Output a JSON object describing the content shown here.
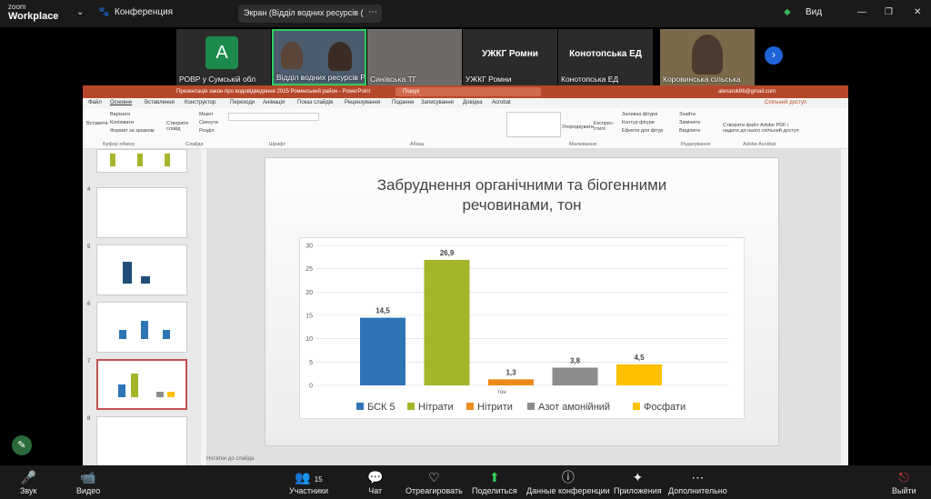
{
  "zoom": {
    "logo_line1": "zoom",
    "logo_line2": "Workplace",
    "meeting_label": "Конференция",
    "share_label": "Экран (Відділ водних ресурсів (",
    "view_label": "Вид"
  },
  "participants": [
    {
      "name": "РОВР у Сумській обл",
      "initial": "A"
    },
    {
      "name": "Відділ водних ресурсів Р..."
    },
    {
      "name": "Синівська ТГ"
    },
    {
      "name": "УЖКГ Ромни",
      "big": "УЖКГ Ромни"
    },
    {
      "name": "Конотопська ЕД",
      "big": "Конотопська ЕД"
    },
    {
      "name": "Коровинська сільська"
    }
  ],
  "ppt": {
    "title": "Презентація закон про водовідведення 2025 Роменський район  -  PowerPoint",
    "search": "Пошук",
    "user": "alenaruk86@gmail.com",
    "share": "Спільний доступ",
    "tabs": [
      "Файл",
      "Основне",
      "Вставлення",
      "Конструктор",
      "Переходи",
      "Анімація",
      "Показ слайдів",
      "Рецензування",
      "Подання",
      "Записування",
      "Довідка",
      "Acrobat"
    ],
    "groups": [
      "Буфер обміну",
      "Слайди",
      "Шрифт",
      "Абзац",
      "Малювання",
      "Редагування",
      "Adobe Acrobat"
    ],
    "ribbon_items": [
      "Вставити",
      "Вирізати",
      "Копіювати",
      "Формат за зразком",
      "Створити слайд",
      "Макет",
      "Скинути",
      "Розділ",
      "Упорядкувати",
      "Експрес-стилі",
      "Заливка фігури",
      "Контур фігури",
      "Ефекти для фігур",
      "Знайти",
      "Замінити",
      "Виділити",
      "Створити файл Adobe PDF і надати до нього спільний доступ"
    ],
    "notes": "Нотатки до слайда",
    "slide_numbers": [
      "4",
      "5",
      "6",
      "7",
      "8"
    ]
  },
  "slide": {
    "title_line1": "Забруднення органічними та біогенними",
    "title_line2": "речовинами, тон"
  },
  "chart_data": {
    "type": "bar",
    "title": "",
    "xlabel": "тон",
    "categories": [
      "БСК 5",
      "Нітрати",
      "Нітрити",
      "Азот амонійний",
      "Фосфати"
    ],
    "values": [
      14.5,
      26.9,
      1.3,
      3.8,
      4.5
    ],
    "value_labels": [
      "14,5",
      "26,9",
      "1,3",
      "3,8",
      "4,5"
    ],
    "colors": [
      "#2e75b6",
      "#a5b52a",
      "#ed8b1a",
      "#8c8c8c",
      "#ffc000"
    ],
    "yticks": [
      "0",
      "5",
      "10",
      "15",
      "20",
      "25",
      "30"
    ],
    "ylim": [
      0,
      30
    ],
    "legend": "bottom",
    "grid": true
  },
  "toolbar": {
    "sound": "Звук",
    "video": "Видео",
    "participants": "Участники",
    "participants_count": "15",
    "chat": "Чат",
    "react": "Отреагировать",
    "share": "Поделиться",
    "info": "Данные конференции",
    "apps": "Приложения",
    "more": "Дополнительно",
    "leave": "Выйти"
  }
}
